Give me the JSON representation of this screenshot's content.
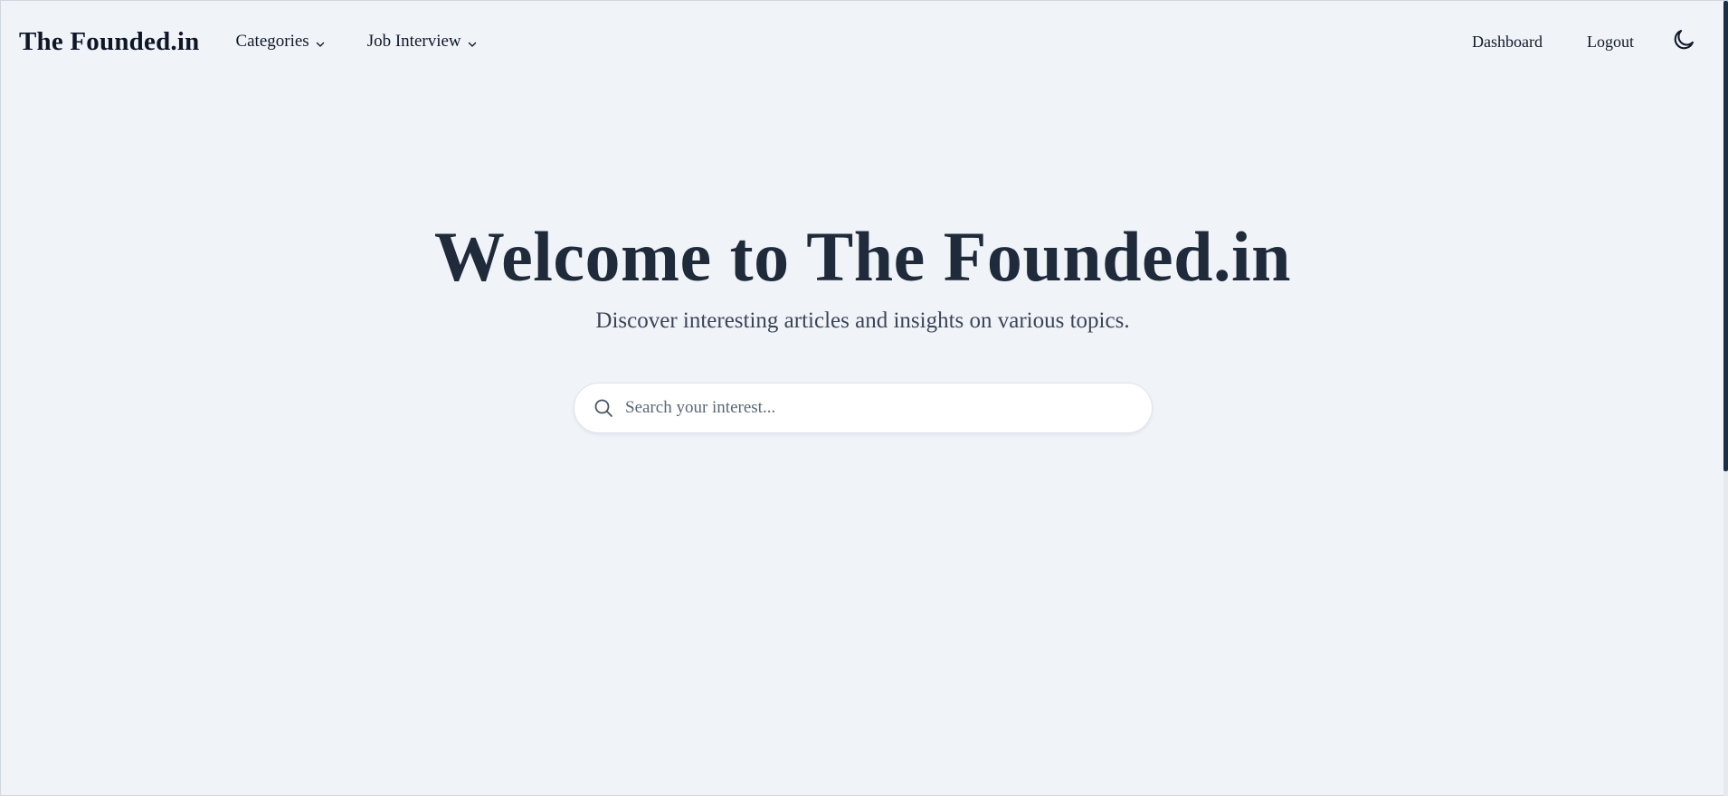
{
  "navbar": {
    "brand": "The Founded.in",
    "menus": [
      {
        "label": "Categories",
        "icon": "chevron-down-icon"
      },
      {
        "label": "Job Interview",
        "icon": "chevron-down-icon"
      }
    ],
    "links": {
      "dashboard": "Dashboard",
      "logout": "Logout"
    },
    "theme_toggle_icon": "moon-icon"
  },
  "hero": {
    "title": "Welcome to The Founded.in",
    "subtitle": "Discover interesting articles and insights on various topics."
  },
  "search": {
    "placeholder": "Search your interest...",
    "value": "",
    "icon": "search-icon"
  },
  "colors": {
    "background": "#f0f4f9",
    "title": "#1f2a3a",
    "scroll_thumb": "#1c2d4a"
  }
}
